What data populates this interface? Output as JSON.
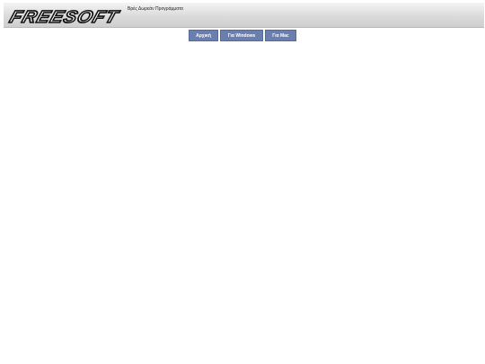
{
  "header": {
    "logo_text": "FREESOFT",
    "tagline": "Βρές Δωρεάν Προγράμματα"
  },
  "nav": {
    "items": [
      {
        "label": "Αρχική"
      },
      {
        "label": "Για Windows"
      },
      {
        "label": "Για Mac"
      }
    ]
  },
  "colors": {
    "nav_button": "#6a7fb0",
    "nav_text": "#ffffff",
    "logo": "#111111"
  }
}
